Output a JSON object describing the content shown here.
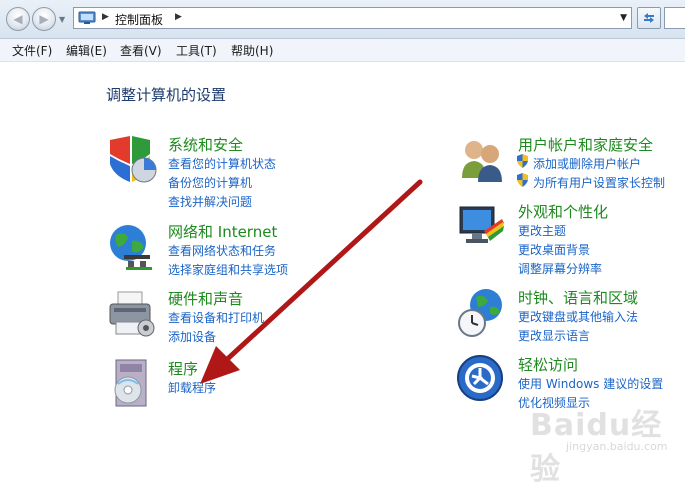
{
  "nav": {
    "breadcrumb": "控制面板"
  },
  "menu": {
    "items": [
      "文件(F)",
      "编辑(E)",
      "查看(V)",
      "工具(T)",
      "帮助(H)"
    ]
  },
  "content": {
    "title": "调整计算机的设置",
    "left": [
      {
        "title": "系统和安全",
        "icon": "shield-pie-icon",
        "links": [
          "查看您的计算机状态",
          "备份您的计算机",
          "查找并解决问题"
        ]
      },
      {
        "title": "网络和 Internet",
        "icon": "globe-network-icon",
        "links": [
          "查看网络状态和任务",
          "选择家庭组和共享选项"
        ]
      },
      {
        "title": "硬件和声音",
        "icon": "printer-icon",
        "links": [
          "查看设备和打印机",
          "添加设备"
        ]
      },
      {
        "title": "程序",
        "icon": "programs-disc-icon",
        "links": [
          "卸载程序"
        ]
      }
    ],
    "right": [
      {
        "title": "用户帐户和家庭安全",
        "icon": "users-icon",
        "links": [
          "添加或删除用户帐户",
          "为所有用户设置家长控制"
        ]
      },
      {
        "title": "外观和个性化",
        "icon": "monitor-palette-icon",
        "links": [
          "更改主题",
          "更改桌面背景",
          "调整屏幕分辨率"
        ]
      },
      {
        "title": "时钟、语言和区域",
        "icon": "clock-globe-icon",
        "links": [
          "更改键盘或其他输入法",
          "更改显示语言"
        ]
      },
      {
        "title": "轻松访问",
        "icon": "ease-of-access-icon",
        "links": [
          "使用 Windows 建议的设置",
          "优化视频显示"
        ]
      }
    ]
  },
  "watermark": {
    "text": "Baidu经验",
    "sub": "jingyan.baidu.com"
  },
  "colors": {
    "category_title": "#1e8a1e",
    "link": "#1a64c8",
    "annotation_arrow": "#b01818"
  }
}
